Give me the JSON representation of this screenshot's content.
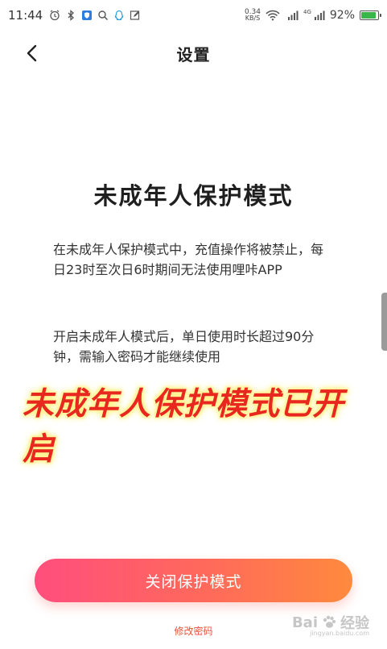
{
  "status_bar": {
    "time": "11:44",
    "net_speed_value": "0.34",
    "net_speed_unit": "KB/S",
    "signal_1_label": "",
    "signal_2_label": "4G",
    "battery_percent": "92%",
    "battery_level": 0.92,
    "battery_color": "#3bb54a"
  },
  "header": {
    "title": "设置"
  },
  "content": {
    "mode_title": "未成年人保护模式",
    "description_1": "在未成年人保护模式中，充值操作将被禁止，每日23时至次日6时期间无法使用哩咔APP",
    "description_2": "开启未成年人模式后，单日使用时长超过90分钟，需输入密码才能继续使用",
    "overlay_caption": "未成年人保护模式已开启"
  },
  "actions": {
    "close_mode_label": "关闭保护模式",
    "change_password_label": "修改密码"
  },
  "watermark": {
    "brand": "Bai",
    "brand_cn": "经验",
    "sub": "jingyan.baidu.com"
  },
  "colors": {
    "accent_start": "#ff4e7d",
    "accent_end": "#ff8a3d",
    "caption_red": "#e8281e",
    "link": "#e8543a"
  }
}
